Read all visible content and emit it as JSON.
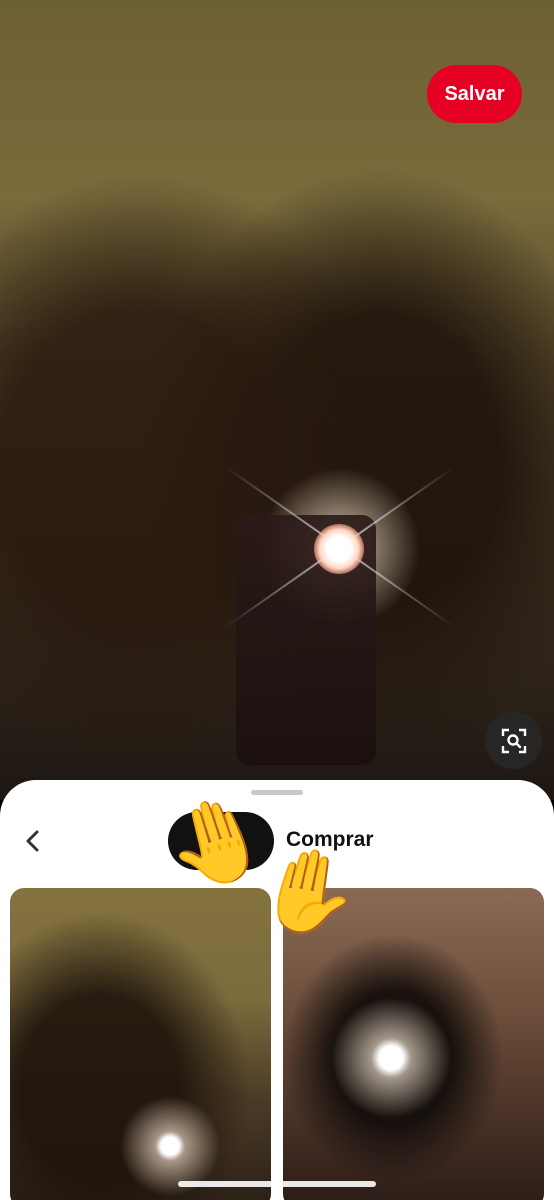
{
  "toolbar": {
    "save_label": "Salvar"
  },
  "sheet": {
    "tabs": [
      {
        "label": ""
      },
      {
        "label": "Comprar"
      }
    ]
  },
  "emoji": {
    "left_hand": "🤚",
    "right_hand": "✋"
  },
  "icons": {
    "lens": "visual-search-icon",
    "back": "chevron-left-icon"
  },
  "colors": {
    "accent": "#e60023",
    "sheet_bg": "#ffffff",
    "tab_active_bg": "#111111"
  }
}
